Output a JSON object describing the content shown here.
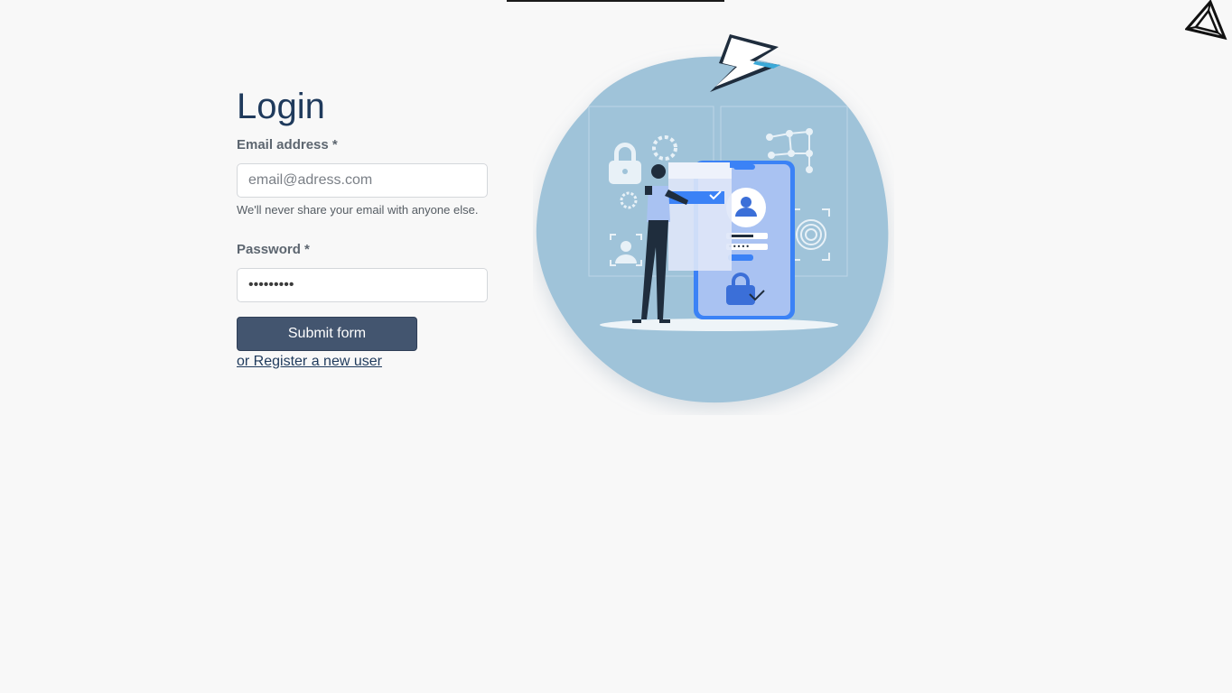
{
  "login": {
    "title": "Login",
    "email_label": "Email address *",
    "email_placeholder": "email@adress.com",
    "email_help": "We'll never share your email with anyone else.",
    "password_label": "Password *",
    "password_value": "password1",
    "submit_label": "Submit form",
    "register_link": "or Register a new user"
  },
  "colors": {
    "background": "#f8f8f8",
    "title": "#1f3a5c",
    "button": "#43556f",
    "blob": "#9fc3d9",
    "accent": "#3b82f6"
  },
  "icons": {
    "corner_logo": "triangle-logo-icon",
    "illustration": "login-security-illustration"
  }
}
